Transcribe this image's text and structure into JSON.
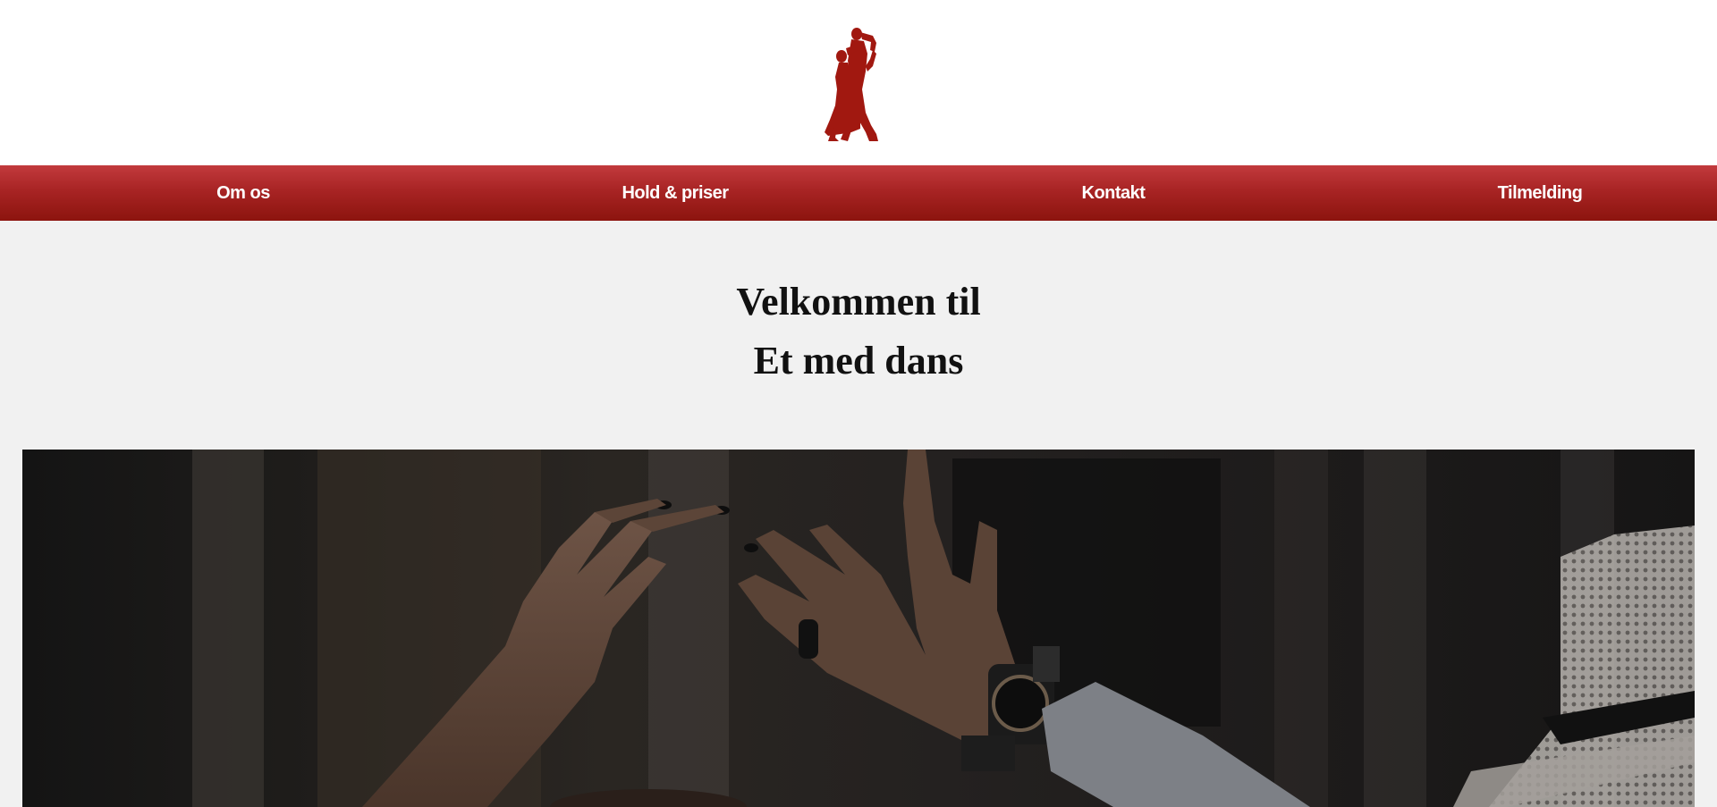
{
  "header": {
    "logo_icon": "dancing-couple-logo-icon",
    "logo_color": "#a11810"
  },
  "nav": {
    "items": [
      {
        "label": "Om os"
      },
      {
        "label": "Hold & priser"
      },
      {
        "label": "Kontakt"
      },
      {
        "label": "Tilmelding"
      }
    ],
    "colors": {
      "top": "#c23a3d",
      "bottom": "#8c140e",
      "text": "#ffffff"
    }
  },
  "hero": {
    "title_line1": "Velkommen til",
    "title_line2": "Et med dans",
    "image": "hero-dance-hands-photo"
  }
}
